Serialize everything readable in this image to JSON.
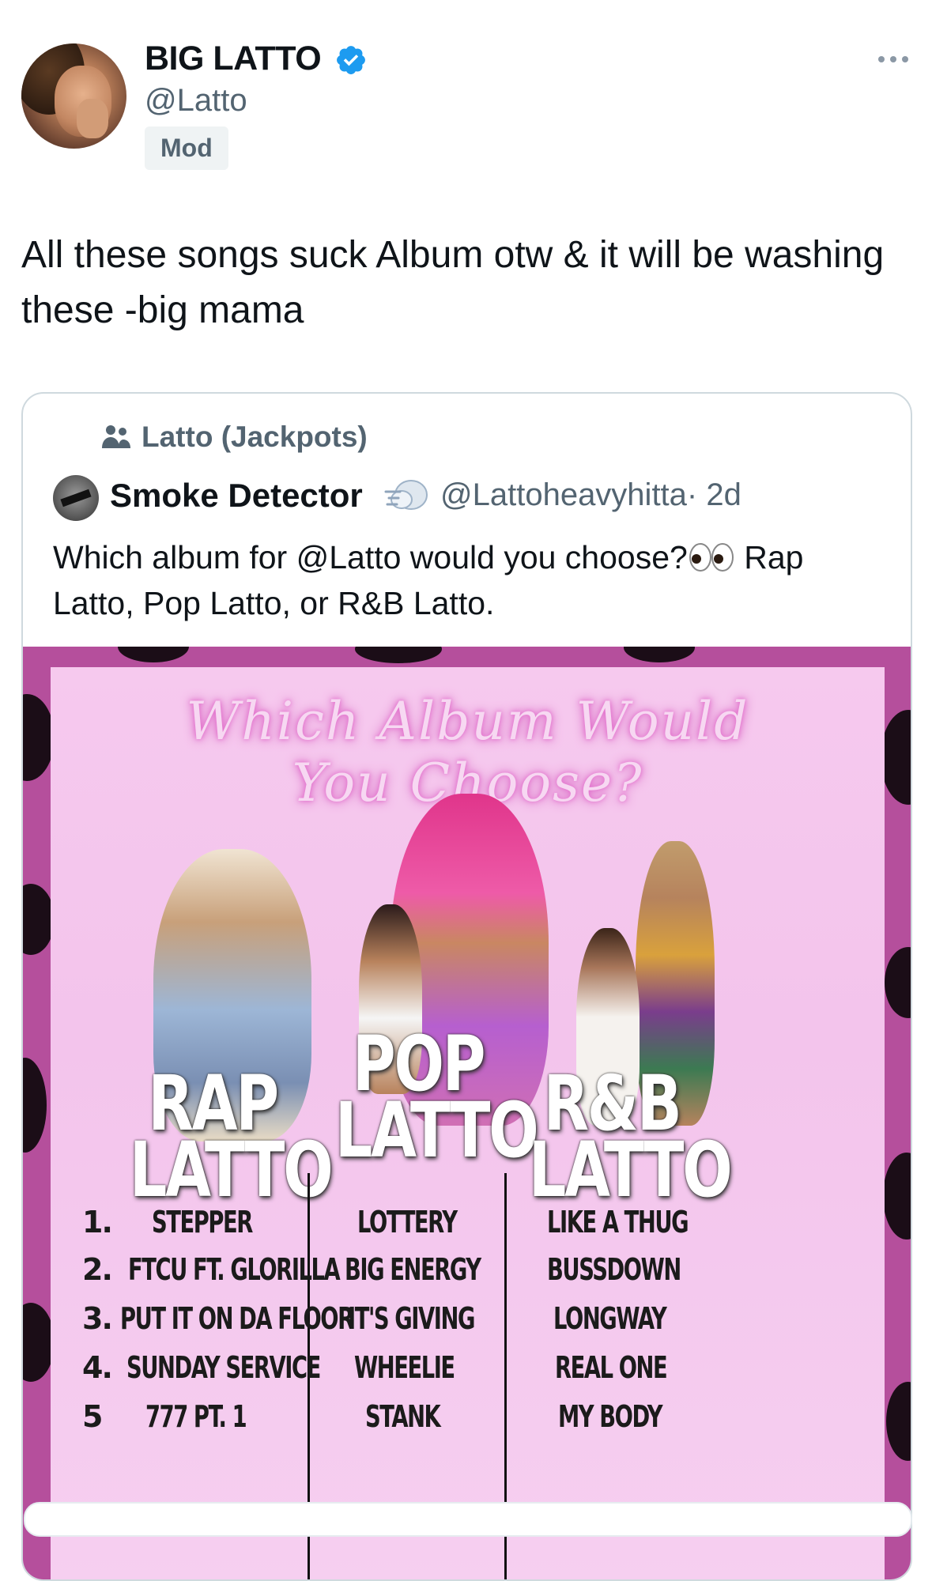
{
  "tweet": {
    "author_name": "BIG LATTO",
    "author_handle": "@Latto",
    "badge": "Mod",
    "text": "All these songs suck Album otw & it will be washing these -big mama"
  },
  "quote": {
    "community": "Latto (Jackpots)",
    "author_name": "Smoke Detector",
    "author_handle": "@Lattoheavyhitta",
    "age": "· 2d",
    "text_before_emoji": "Which album for @Latto would you choose?",
    "text_after_emoji": " Rap Latto, Pop Latto, or R&B Latto."
  },
  "poster": {
    "title_line1": "Which Album Would",
    "title_line2": "You Choose?",
    "columns": [
      {
        "label_top": "RAP",
        "label_bottom": "LATTO",
        "songs": [
          "STEPPER",
          "FTCU FT. GLORILLA",
          "PUT IT ON DA FLOOR",
          "SUNDAY SERVICE",
          "777 PT. 1"
        ]
      },
      {
        "label_top": "POP",
        "label_bottom": "LATTO",
        "songs": [
          "LOTTERY",
          "BIG ENERGY",
          "IT'S GIVING",
          "WHEELIE",
          "STANK"
        ]
      },
      {
        "label_top": "R&B",
        "label_bottom": "LATTO",
        "songs": [
          "LIKE A THUG",
          "BUSSDOWN",
          "LONGWAY",
          "REAL ONE",
          "MY BODY"
        ]
      }
    ],
    "numbers": [
      "1.",
      "2.",
      "3.",
      "4.",
      "5"
    ]
  },
  "colors": {
    "verified_blue": "#1d9bf0",
    "poster_frame": "#b54f9c",
    "poster_bg": "#f4c6ed",
    "neon_pink": "#e46ccc"
  },
  "icons": {
    "verified": "verified-badge-icon",
    "more": "more-options-icon",
    "community": "community-people-icon",
    "smoke_emoji": "dashing-away-emoji",
    "eyes_emoji": "eyes-emoji"
  }
}
